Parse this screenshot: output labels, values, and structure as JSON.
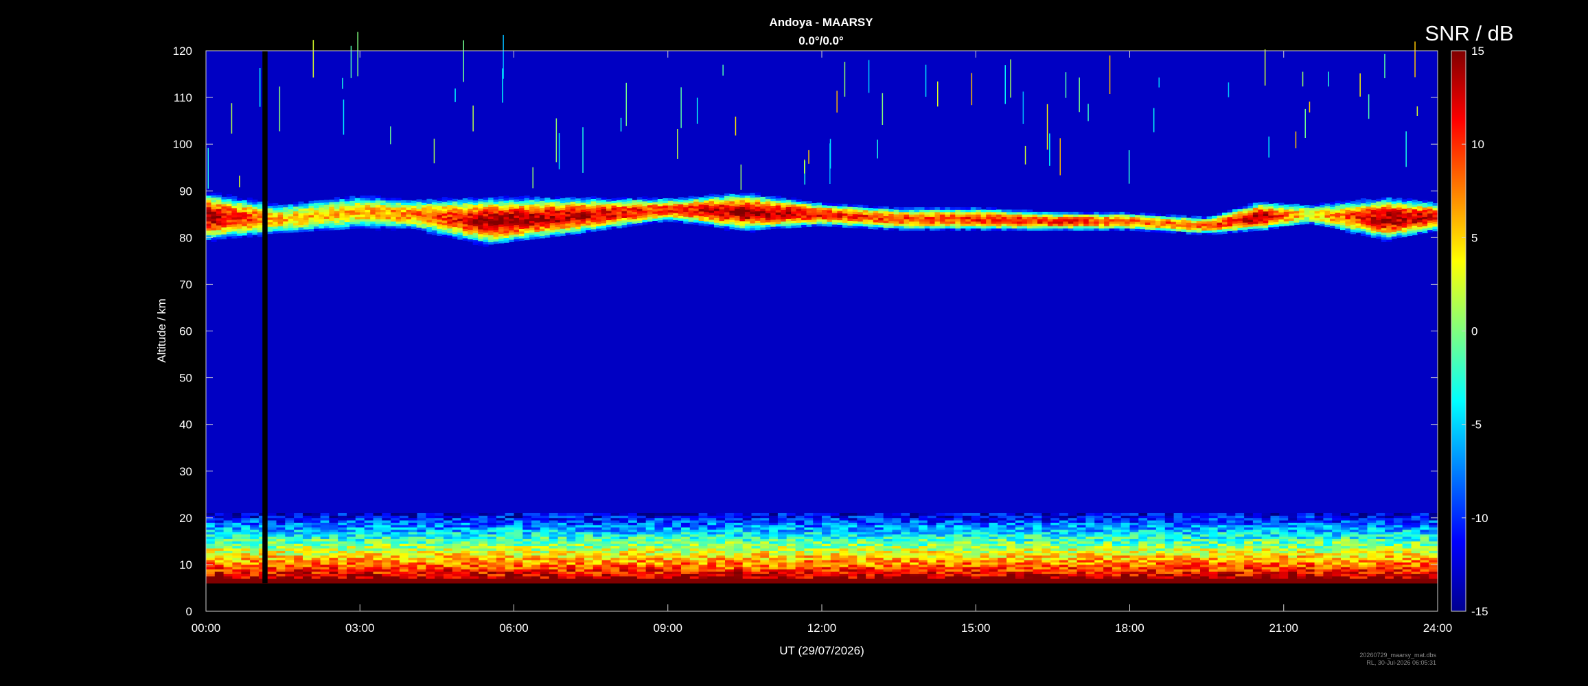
{
  "chart_data": {
    "type": "heatmap",
    "title": "Andoya - MAARSY",
    "subtitle": "0.0°/0.0°",
    "xlabel": "UT (29/07/2026)",
    "ylabel": "Altitude / km",
    "colorbar_label": "SNR / dB",
    "x_ticks": [
      "00:00",
      "03:00",
      "06:00",
      "09:00",
      "12:00",
      "15:00",
      "18:00",
      "21:00",
      "24:00"
    ],
    "x_range_hours": [
      0,
      24
    ],
    "y_ticks": [
      0,
      10,
      20,
      30,
      40,
      50,
      60,
      70,
      80,
      90,
      100,
      110,
      120
    ],
    "y_range_km": [
      0,
      120
    ],
    "colorbar_ticks": [
      15,
      10,
      5,
      0,
      -5,
      -10,
      -15
    ],
    "colorbar_range_db": [
      -15,
      15
    ],
    "colormap": "jet",
    "background_snr_db": -13,
    "data_gap": {
      "start_hour": 1.1,
      "end_hour": 1.2
    },
    "lower_echo_layer": {
      "bottom_km": 6,
      "top_km": 21,
      "peak_snr_db": 15
    },
    "pmse_layer": [
      {
        "hour": 0.0,
        "bottom_km": 80,
        "top_km": 89,
        "peak_snr_db": 14
      },
      {
        "hour": 1.5,
        "bottom_km": 81,
        "top_km": 87,
        "peak_snr_db": 6
      },
      {
        "hour": 3.0,
        "bottom_km": 82,
        "top_km": 89,
        "peak_snr_db": 6
      },
      {
        "hour": 4.0,
        "bottom_km": 82,
        "top_km": 88,
        "peak_snr_db": 7
      },
      {
        "hour": 5.5,
        "bottom_km": 79,
        "top_km": 88,
        "peak_snr_db": 14
      },
      {
        "hour": 7.0,
        "bottom_km": 81,
        "top_km": 88,
        "peak_snr_db": 13
      },
      {
        "hour": 9.0,
        "bottom_km": 84,
        "top_km": 88,
        "peak_snr_db": 10
      },
      {
        "hour": 10.5,
        "bottom_km": 82,
        "top_km": 89,
        "peak_snr_db": 14
      },
      {
        "hour": 12.0,
        "bottom_km": 83,
        "top_km": 87,
        "peak_snr_db": 11
      },
      {
        "hour": 13.5,
        "bottom_km": 82,
        "top_km": 86,
        "peak_snr_db": 9
      },
      {
        "hour": 15.0,
        "bottom_km": 82,
        "top_km": 86,
        "peak_snr_db": 10
      },
      {
        "hour": 16.5,
        "bottom_km": 82,
        "top_km": 85,
        "peak_snr_db": 11
      },
      {
        "hour": 18.0,
        "bottom_km": 82,
        "top_km": 85,
        "peak_snr_db": 9
      },
      {
        "hour": 19.5,
        "bottom_km": 81,
        "top_km": 84,
        "peak_snr_db": 8
      },
      {
        "hour": 20.5,
        "bottom_km": 82,
        "top_km": 87,
        "peak_snr_db": 14
      },
      {
        "hour": 21.5,
        "bottom_km": 83,
        "top_km": 87,
        "peak_snr_db": 4
      },
      {
        "hour": 23.0,
        "bottom_km": 80,
        "top_km": 88,
        "peak_snr_db": 14
      },
      {
        "hour": 24.0,
        "bottom_km": 82,
        "top_km": 87,
        "peak_snr_db": 12
      }
    ]
  },
  "footer": {
    "filename": "20260729_maarsy_mat.dbs",
    "credit": "RL, 30-Jul-2026 06:05:31"
  }
}
